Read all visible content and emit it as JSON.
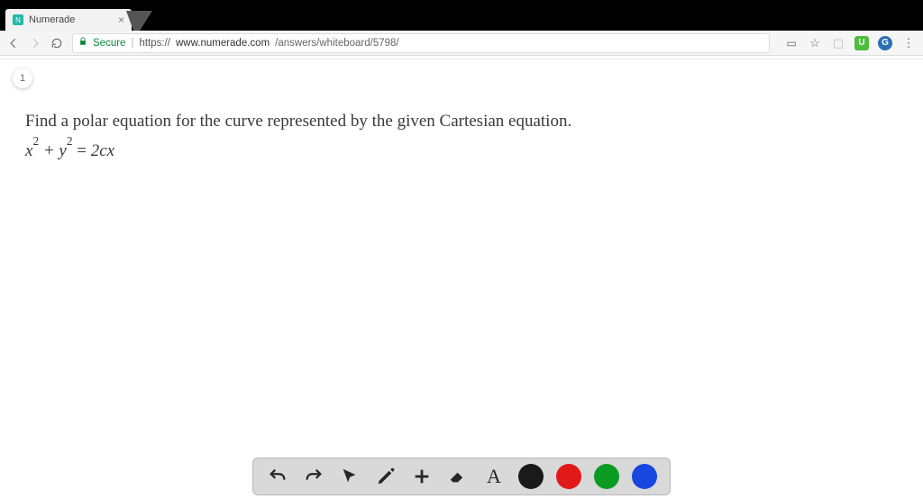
{
  "browser": {
    "tab_title": "Numerade",
    "secure_label": "Secure",
    "url_protocol": "https://",
    "url_host": "www.numerade.com",
    "url_path": "/answers/whiteboard/5798/",
    "ext_green": "U",
    "ext_grammarly": "G"
  },
  "page": {
    "step": "1",
    "statement": "Find a polar equation for the curve represented by the given Cartesian equation.",
    "equation_html": "x<sup>2</sup> + y<sup>2</sup> = 2cx"
  },
  "toolbar": {
    "undo": "undo",
    "redo": "redo",
    "pointer": "pointer",
    "pencil": "pencil",
    "plus": "plus",
    "eraser": "eraser",
    "text": "A",
    "colors": {
      "black": "#1a1a1a",
      "red": "#e11919",
      "green": "#0b9b23",
      "blue": "#1746e0"
    }
  }
}
